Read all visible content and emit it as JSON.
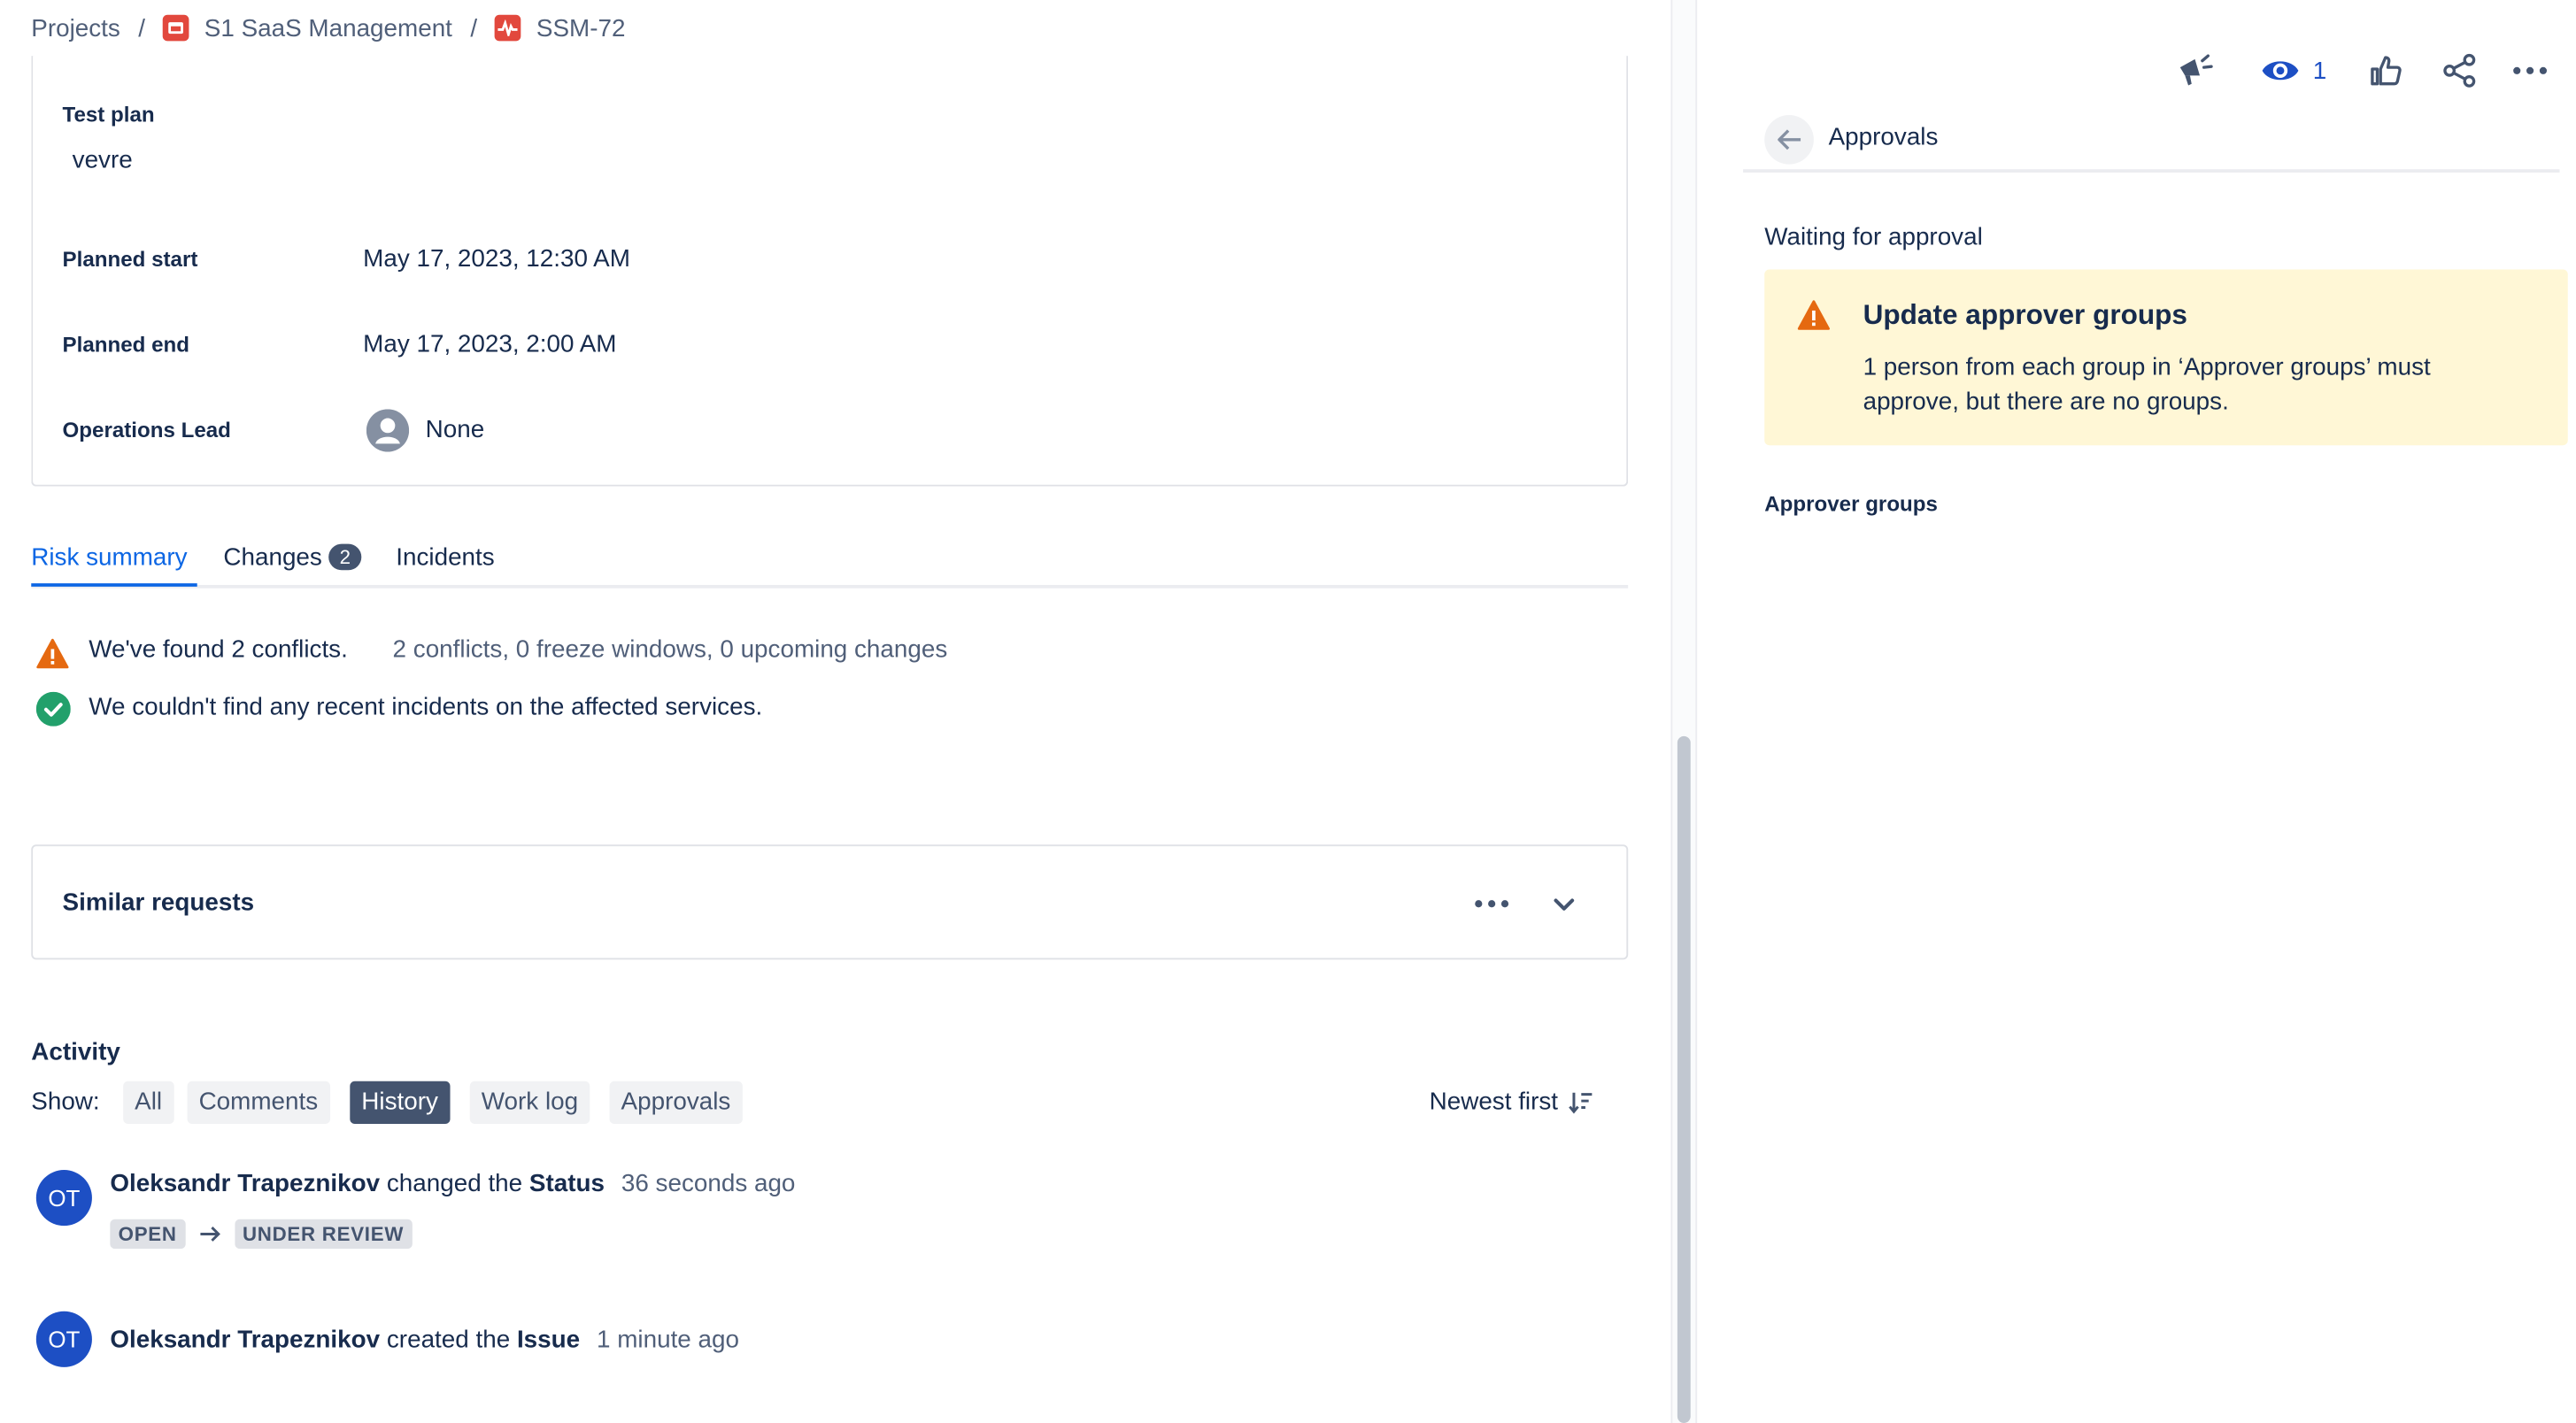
{
  "breadcrumb": {
    "projects": "Projects",
    "project": "S1 SaaS Management",
    "issue": "SSM-72"
  },
  "details": {
    "test_plan_label": "Test plan",
    "test_plan_value": "vevre",
    "planned_start_label": "Planned start",
    "planned_start_value": "May 17, 2023, 12:30 AM",
    "planned_end_label": "Planned end",
    "planned_end_value": "May 17, 2023, 2:00 AM",
    "operations_lead_label": "Operations Lead",
    "operations_lead_value": "None"
  },
  "tabs": {
    "risk_summary": "Risk summary",
    "changes": "Changes",
    "changes_count": "2",
    "incidents": "Incidents"
  },
  "risk": {
    "conflicts": "We've found 2 conflicts.",
    "conflicts_detail": "2 conflicts, 0 freeze windows, 0 upcoming changes",
    "incidents": "We couldn't find any recent incidents on the affected services."
  },
  "similar": {
    "title": "Similar requests"
  },
  "activity": {
    "title": "Activity",
    "show_label": "Show:",
    "filters": [
      "All",
      "Comments",
      "History",
      "Work log",
      "Approvals"
    ],
    "active_filter": "History",
    "sort_label": "Newest first",
    "entries": [
      {
        "initials": "OT",
        "user": "Oleksandr Trapeznikov",
        "action": "changed the",
        "field": "Status",
        "time": "36 seconds ago",
        "from": "OPEN",
        "to": "UNDER REVIEW"
      },
      {
        "initials": "OT",
        "user": "Oleksandr Trapeznikov",
        "action": "created the",
        "field": "Issue",
        "time": "1 minute ago"
      }
    ]
  },
  "toolbar": {
    "watch_count": "1"
  },
  "approvals": {
    "title": "Approvals",
    "waiting": "Waiting for approval",
    "warning_title": "Update approver groups",
    "warning_body_line1": "1 person from each group in ‘Approver groups’ must",
    "warning_body_line2": "approve, but there are no groups.",
    "approver_groups_label": "Approver groups"
  },
  "colors": {
    "accent": "#0c66e4",
    "warning": "#e56910",
    "success": "#22a06b",
    "avatar": "#1d4fc4",
    "warning_bg": "#fff7d6"
  }
}
